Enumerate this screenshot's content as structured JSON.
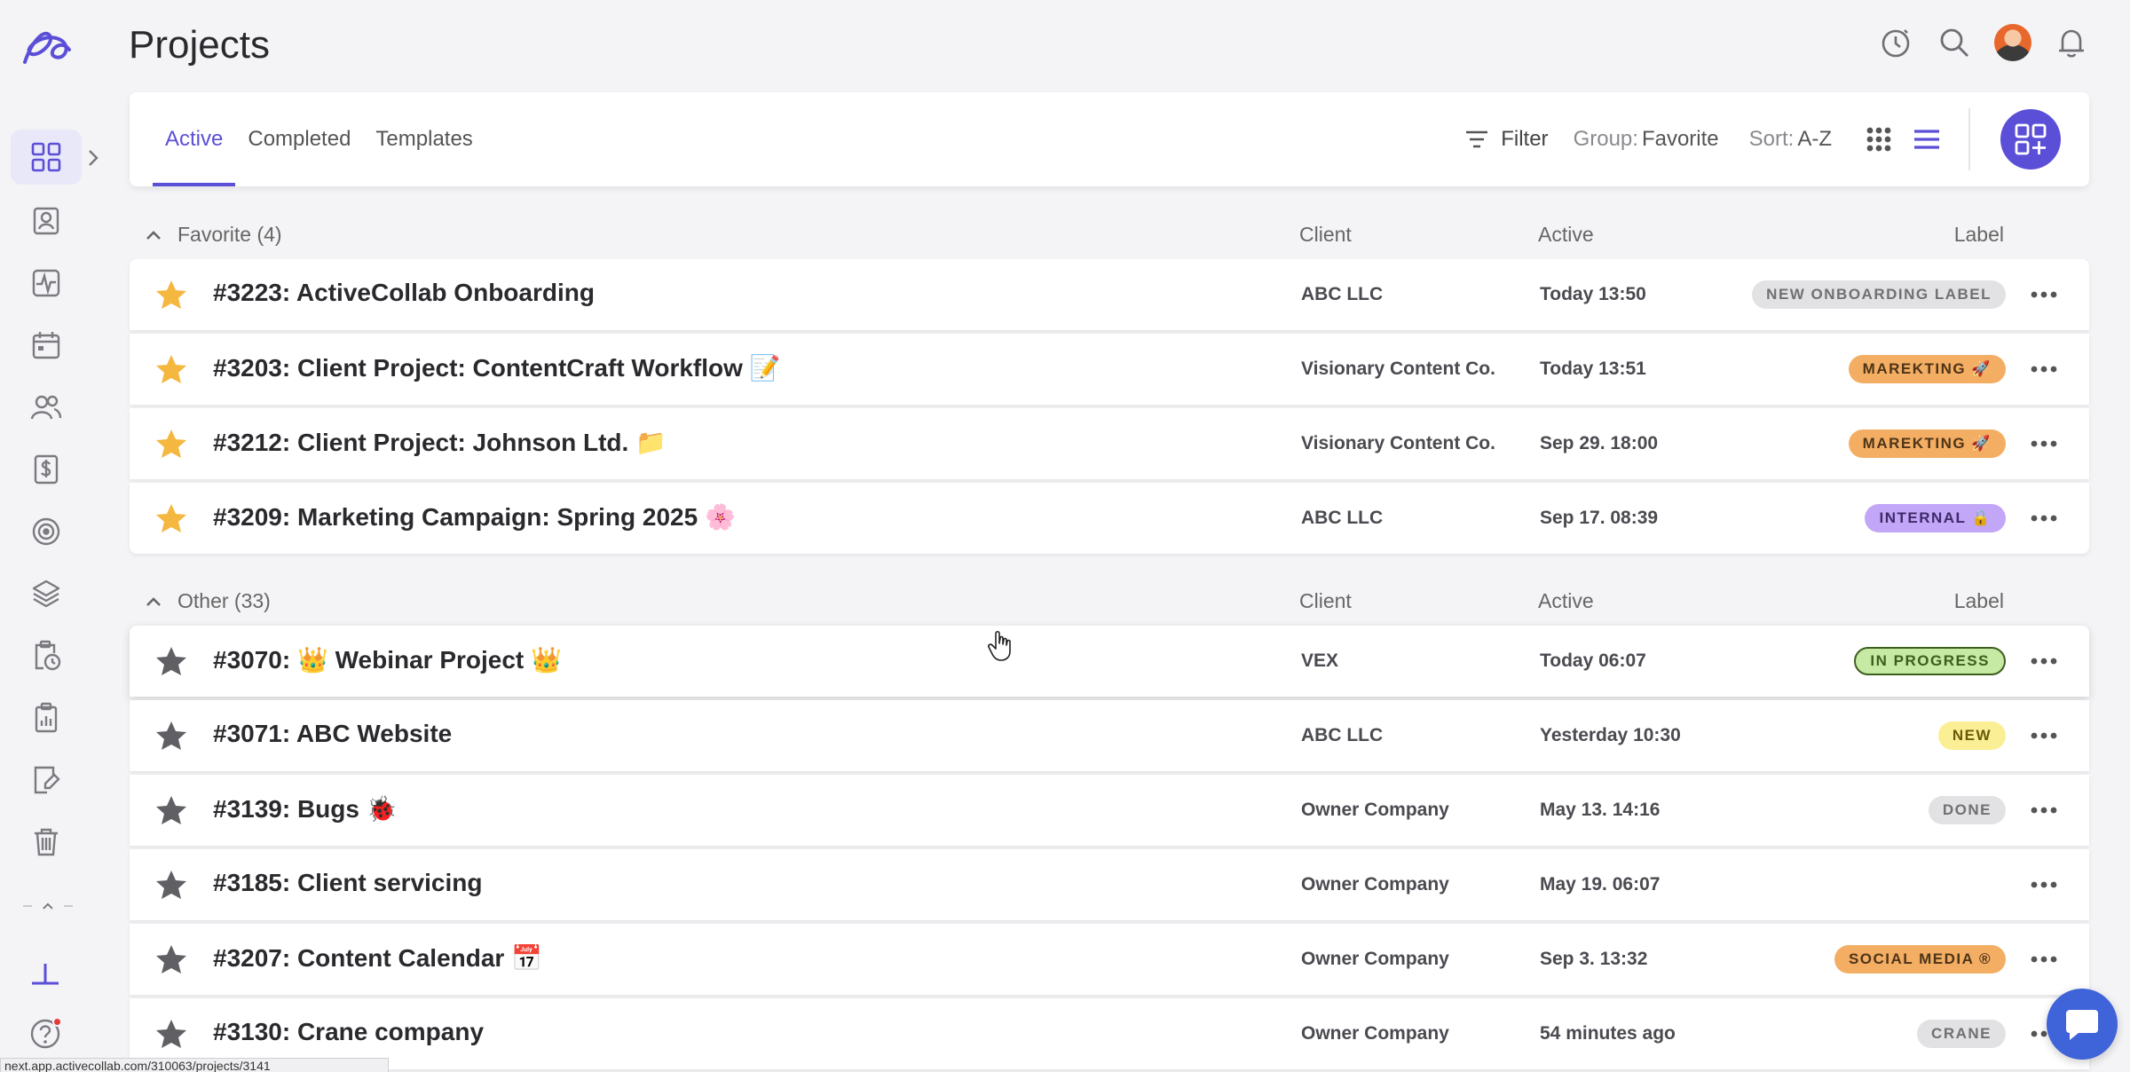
{
  "page": {
    "title": "Projects"
  },
  "tabs": [
    {
      "label": "Active",
      "active": true
    },
    {
      "label": "Completed",
      "active": false
    },
    {
      "label": "Templates",
      "active": false
    }
  ],
  "toolbar": {
    "filter_label": "Filter",
    "group_prefix": "Group:",
    "group_value": "Favorite",
    "sort_prefix": "Sort:",
    "sort_value": "A-Z"
  },
  "columns": {
    "client": "Client",
    "active": "Active",
    "label": "Label"
  },
  "groups": [
    {
      "title": "Favorite (4)",
      "rows": [
        {
          "title": "#3223: ActiveCollab Onboarding",
          "client": "ABC LLC",
          "active": "Today 13:50",
          "label": "NEW ONBOARDING LABEL",
          "label_bg": "#e2e2e4",
          "label_fg": "#707074",
          "favorite": true
        },
        {
          "title": "#3203: Client Project: ContentCraft Workflow 📝",
          "client": "Visionary Content Co.",
          "active": "Today 13:51",
          "label": "MAREKTING 🚀",
          "label_bg": "#f3ae63",
          "label_fg": "#4e3418",
          "favorite": true
        },
        {
          "title": "#3212: Client Project: Johnson Ltd. 📁",
          "client": "Visionary Content Co.",
          "active": "Sep 29. 18:00",
          "label": "MAREKTING 🚀",
          "label_bg": "#f3ae63",
          "label_fg": "#4e3418",
          "favorite": true
        },
        {
          "title": "#3209: Marketing Campaign: Spring 2025 🌸",
          "client": "ABC LLC",
          "active": "Sep 17. 08:39",
          "label": "INTERNAL 🔒",
          "label_bg": "#c2a6f7",
          "label_fg": "#3f2a6a",
          "favorite": true
        }
      ]
    },
    {
      "title": "Other (33)",
      "rows": [
        {
          "title": "#3070: 👑 Webinar Project 👑",
          "client": "VEX",
          "active": "Today 06:07",
          "label": "IN PROGRESS",
          "label_bg": "#c6e9a4",
          "label_fg": "#3c5f1d",
          "favorite": false
        },
        {
          "title": "#3071: ABC Website",
          "client": "ABC LLC",
          "active": "Yesterday 10:30",
          "label": "NEW",
          "label_bg": "#fbef95",
          "label_fg": "#6a5a0a",
          "favorite": false
        },
        {
          "title": "#3139: Bugs 🐞",
          "client": "Owner Company",
          "active": "May 13. 14:16",
          "label": "DONE",
          "label_bg": "#e2e2e4",
          "label_fg": "#707074",
          "favorite": false
        },
        {
          "title": "#3185: Client servicing",
          "client": "Owner Company",
          "active": "May 19. 06:07",
          "label": "",
          "label_bg": "",
          "label_fg": "",
          "favorite": false
        },
        {
          "title": "#3207: Content Calendar 📅",
          "client": "Owner Company",
          "active": "Sep 3. 13:32",
          "label": "SOCIAL MEDIA ®",
          "label_bg": "#f3ae63",
          "label_fg": "#4e3418",
          "favorite": false
        },
        {
          "title": "#3130: Crane company",
          "client": "Owner Company",
          "active": "54 minutes ago",
          "label": "CRANE",
          "label_bg": "#e2e2e4",
          "label_fg": "#707074",
          "favorite": false
        }
      ]
    }
  ],
  "status_url": "next.app.activecollab.com/310063/projects/3141",
  "colors": {
    "accent": "#5b4fd8",
    "star_fav": "#f4b740",
    "star_other": "#5f5f64",
    "chat": "#3f63d8"
  }
}
